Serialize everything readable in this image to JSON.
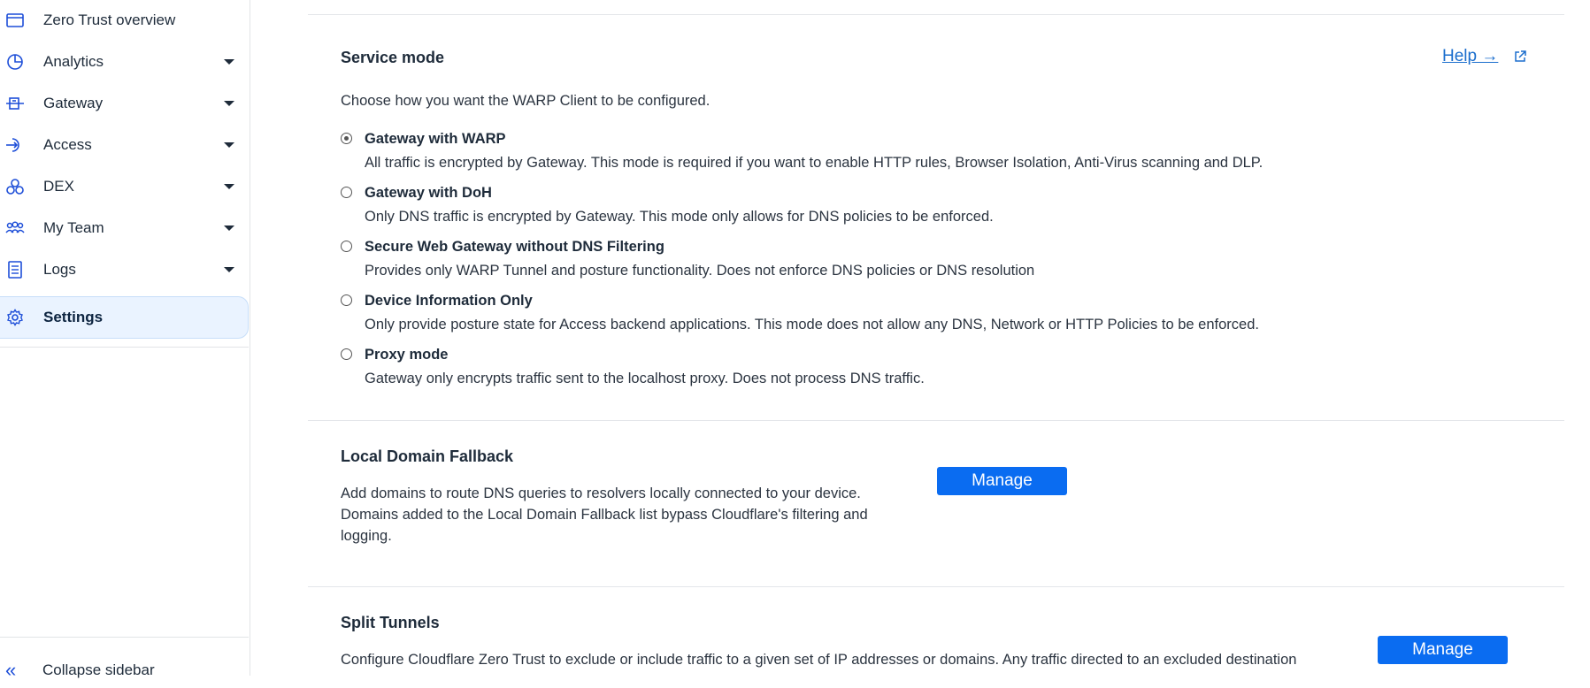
{
  "sidebar": {
    "items": [
      {
        "label": "Zero Trust overview",
        "icon": "browser-window-icon",
        "has_caret": false
      },
      {
        "label": "Analytics",
        "icon": "pie-chart-icon",
        "has_caret": true
      },
      {
        "label": "Gateway",
        "icon": "gateway-icon",
        "has_caret": true
      },
      {
        "label": "Access",
        "icon": "access-icon",
        "has_caret": true
      },
      {
        "label": "DEX",
        "icon": "dex-icon",
        "has_caret": true
      },
      {
        "label": "My Team",
        "icon": "team-icon",
        "has_caret": true
      },
      {
        "label": "Logs",
        "icon": "logs-icon",
        "has_caret": true
      },
      {
        "label": "Settings",
        "icon": "gear-icon",
        "has_caret": false,
        "active": true
      }
    ],
    "collapse_label": "Collapse sidebar"
  },
  "service_mode": {
    "title": "Service mode",
    "help_label": "Help →",
    "description": "Choose how you want the WARP Client to be configured.",
    "options": [
      {
        "label": "Gateway with WARP",
        "description": "All traffic is encrypted by Gateway. This mode is required if you want to enable HTTP rules, Browser Isolation, Anti-Virus scanning and DLP.",
        "selected": true
      },
      {
        "label": "Gateway with DoH",
        "description": "Only DNS traffic is encrypted by Gateway. This mode only allows for DNS policies to be enforced.",
        "selected": false
      },
      {
        "label": "Secure Web Gateway without DNS Filtering",
        "description": "Provides only WARP Tunnel and posture functionality. Does not enforce DNS policies or DNS resolution",
        "selected": false
      },
      {
        "label": "Device Information Only",
        "description": "Only provide posture state for Access backend applications. This mode does not allow any DNS, Network or HTTP Policies to be enforced.",
        "selected": false
      },
      {
        "label": "Proxy mode",
        "description": "Gateway only encrypts traffic sent to the localhost proxy. Does not process DNS traffic.",
        "selected": false
      }
    ]
  },
  "local_domain_fallback": {
    "title": "Local Domain Fallback",
    "description_lines": [
      "Add domains to route DNS queries to resolvers locally connected to your device.",
      "Domains added to the Local Domain Fallback list bypass Cloudflare's filtering and",
      "logging."
    ],
    "button_label": "Manage"
  },
  "split_tunnels": {
    "title": "Split Tunnels",
    "description": "Configure Cloudflare Zero Trust to exclude or include traffic to a given set of IP addresses or domains. Any traffic directed to an excluded destination",
    "button_label": "Manage"
  },
  "colors": {
    "accent": "#0a6cf1",
    "link": "#1b6ecd",
    "active_bg": "#eaf3ff",
    "icon": "#1d4ed8"
  }
}
